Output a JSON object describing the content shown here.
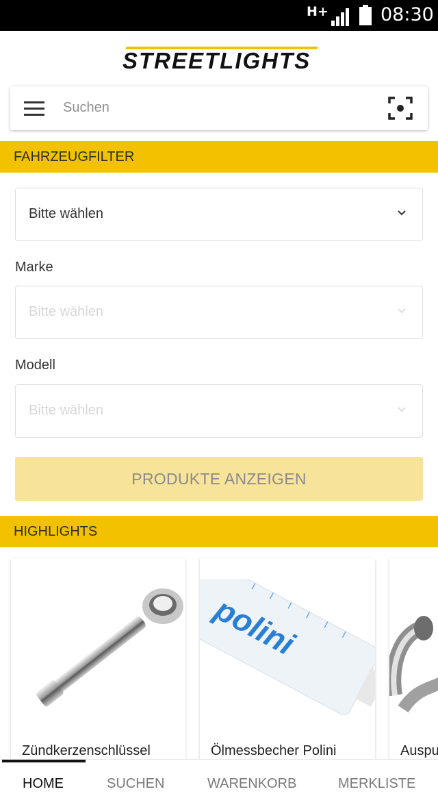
{
  "status_bar": {
    "network": "H+",
    "time": "08:30"
  },
  "brand": {
    "logo_text": "STREETLIGHTS",
    "accent": "#f2c200"
  },
  "search": {
    "placeholder": "Suchen"
  },
  "vehicle_filter": {
    "header": "FAHRZEUGFILTER",
    "type_select": {
      "value": "Bitte wählen"
    },
    "brand_label": "Marke",
    "brand_select": {
      "value": "Bitte wählen"
    },
    "model_label": "Modell",
    "model_select": {
      "value": "Bitte wählen"
    },
    "submit_label": "PRODUKTE ANZEIGEN"
  },
  "highlights": {
    "header": "HIGHLIGHTS",
    "items": [
      {
        "title": "Zündkerzenschlüssel",
        "image": "spark-plug-wrench"
      },
      {
        "title": "Ölmessbecher Polini",
        "image": "polini-oil-bottle",
        "image_text": "polini"
      },
      {
        "title": "Auspu",
        "image": "exhaust-pipe"
      }
    ]
  },
  "bottom_nav": {
    "tabs": [
      {
        "label": "HOME",
        "active": true
      },
      {
        "label": "SUCHEN",
        "active": false
      },
      {
        "label": "WARENKORB",
        "active": false
      },
      {
        "label": "MERKLISTE",
        "active": false
      }
    ]
  }
}
